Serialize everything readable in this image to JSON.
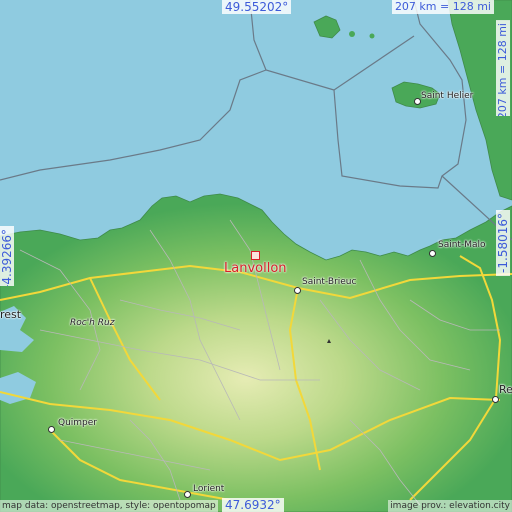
{
  "map": {
    "place_name": "Lanvollon",
    "cities": [
      {
        "key": "saint_helier",
        "name": "Saint Helier"
      },
      {
        "key": "saint_malo",
        "name": "Saint-Malo"
      },
      {
        "key": "saint_brieuc",
        "name": "Saint-Brieuc"
      },
      {
        "key": "roch_ruz",
        "name": "Roc'h Ruz"
      },
      {
        "key": "quimper",
        "name": "Quimper"
      },
      {
        "key": "lorient",
        "name": "Lorient"
      },
      {
        "key": "brest_partial",
        "name": "rest"
      },
      {
        "key": "rennes_partial",
        "name": "Re"
      }
    ],
    "coordinates": {
      "north": "49.55202°",
      "south": "47.6932°",
      "west": "-4.39266°",
      "east": "-1.58016°"
    },
    "scale": {
      "horizontal": "207 km = 128 mi",
      "vertical": "207 km = 128 mi"
    },
    "attribution": {
      "left": "map data: openstreetmap, style: opentopomap",
      "right": "image prov.: elevation.city"
    },
    "colors": {
      "sea": "#8fcbe0",
      "land_low": "#4aa858",
      "land_mid": "#7cc062",
      "land_high": "#dfe8a8",
      "roads": "#f2d83a",
      "marker": "#d8202a",
      "coordinate_text": "#3d5bd9"
    }
  }
}
